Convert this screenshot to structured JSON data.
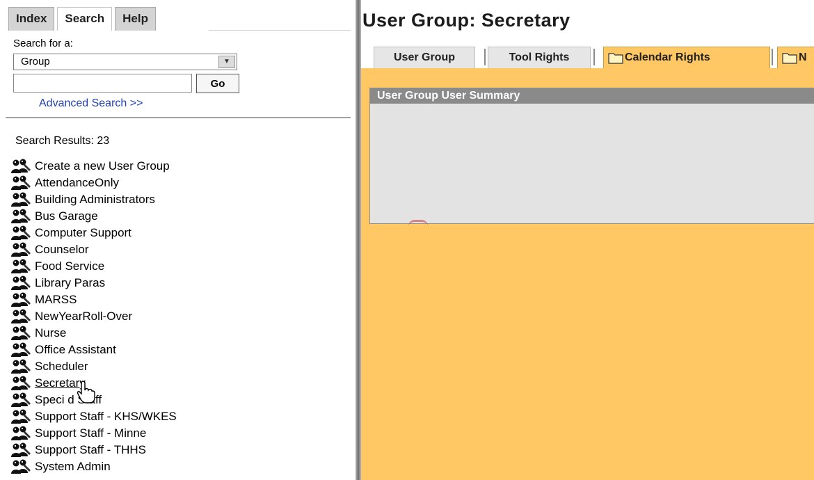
{
  "left_tabs": {
    "index": "Index",
    "search": "Search",
    "help": "Help"
  },
  "search": {
    "search_for_label": "Search for a:",
    "type_selected": "Group",
    "input_value": "",
    "go_label": "Go",
    "advanced_link": "Advanced Search >>"
  },
  "results": {
    "count_label": "Search Results: 23",
    "items": [
      {
        "label": "Create a new User Group"
      },
      {
        "label": "AttendanceOnly"
      },
      {
        "label": "Building Administrators"
      },
      {
        "label": "Bus Garage"
      },
      {
        "label": "Computer Support"
      },
      {
        "label": "Counselor"
      },
      {
        "label": "Food Service"
      },
      {
        "label": "Library Paras"
      },
      {
        "label": "MARSS"
      },
      {
        "label": "NewYearRoll-Over"
      },
      {
        "label": "Nurse"
      },
      {
        "label": "Office Assistant"
      },
      {
        "label": "Scheduler"
      },
      {
        "label": "Secretary"
      },
      {
        "label": "Speci d Staff"
      },
      {
        "label": "Support Staff - KHS/WKES"
      },
      {
        "label": "Support Staff - Minne"
      },
      {
        "label": "Support Staff - THHS"
      },
      {
        "label": "System Admin"
      }
    ],
    "hovered_item": "Secretary"
  },
  "main": {
    "title": "User Group: Secretary",
    "tabs": {
      "user_group": "User Group",
      "tool_rights": "Tool Rights",
      "calendar_rights": "Calendar Rights",
      "next": "N"
    },
    "panel_title": "User Group User Summary"
  },
  "colors": {
    "accent_orange": "#ffc864",
    "panel_header": "#8a8a8a",
    "link_blue": "#1f3fb3"
  },
  "icons": {
    "group_icon": "user-group-icon",
    "folder_icon": "folder-icon",
    "select_arrow": "chevron-down-icon",
    "cursor": "hand-pointer-icon"
  }
}
